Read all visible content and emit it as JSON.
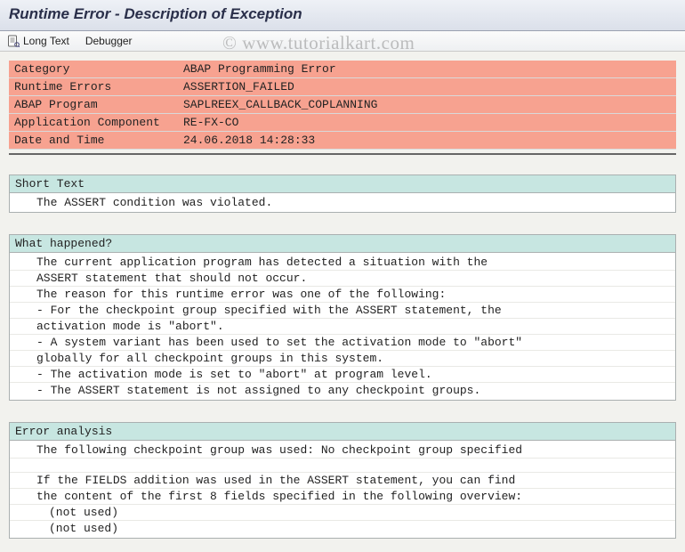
{
  "windowTitle": "Runtime Error - Description of Exception",
  "toolbar": {
    "longText": "Long Text",
    "debugger": "Debugger"
  },
  "watermark": "©  www.tutorialkart.com",
  "summary": [
    {
      "key": "Category",
      "value": "ABAP Programming Error"
    },
    {
      "key": "Runtime Errors",
      "value": "ASSERTION_FAILED"
    },
    {
      "key": "ABAP Program",
      "value": "SAPLREEX_CALLBACK_COPLANNING"
    },
    {
      "key": "Application Component",
      "value": "RE-FX-CO"
    },
    {
      "key": "Date and Time",
      "value": "24.06.2018 14:28:33"
    }
  ],
  "sections": {
    "shortText": {
      "title": "Short Text",
      "lines": [
        {
          "t": "The ASSERT condition was violated."
        }
      ]
    },
    "whatHappened": {
      "title": "What happened?",
      "lines": [
        {
          "t": "The current application program has detected a situation with the"
        },
        {
          "t": "ASSERT statement that should not occur."
        },
        {
          "t": "The reason for this runtime error was one of the following:"
        },
        {
          "t": "- For the checkpoint group specified with the ASSERT statement, the"
        },
        {
          "t": "activation mode is \"abort\"."
        },
        {
          "t": "- A system variant has been used to set the activation mode to \"abort\""
        },
        {
          "t": "globally for all checkpoint groups in this system."
        },
        {
          "t": "- The activation mode is set to \"abort\" at program level."
        },
        {
          "t": "- The ASSERT statement is not assigned to any checkpoint groups."
        }
      ]
    },
    "errorAnalysis": {
      "title": "Error analysis",
      "lines": [
        {
          "t": "The following checkpoint group was used: No checkpoint group specified"
        },
        {
          "t": ""
        },
        {
          "t": "If the FIELDS addition was used in the ASSERT statement, you can find"
        },
        {
          "t": "the content of the first 8 fields specified in the following overview:"
        },
        {
          "t": "(not used)",
          "indent": 2
        },
        {
          "t": "(not used)",
          "indent": 2
        }
      ]
    }
  }
}
